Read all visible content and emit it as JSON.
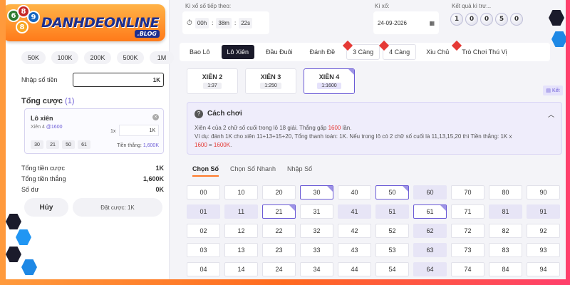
{
  "logo": {
    "text": "DANHDEONLINE",
    "sub": ".BLOG",
    "balls": [
      "6",
      "8",
      "9",
      "8"
    ]
  },
  "left": {
    "chips": [
      "50K",
      "100K",
      "200K",
      "500K",
      "1M"
    ],
    "amount_label": "Nhập số tiền",
    "amount_value": "1K",
    "total_label": "Tổng cược",
    "total_count": "(1)",
    "bet": {
      "title": "Lô xiên",
      "sub": "Xiên 4",
      "rate": "@1600",
      "mult_label": "1x",
      "mult_value": "1K",
      "numbers": [
        "30",
        "21",
        "50",
        "61"
      ],
      "win_label": "Tiền thắng:",
      "win_value": "1,600K"
    },
    "summary": [
      {
        "label": "Tổng tiền cược",
        "value": "1K"
      },
      {
        "label": "Tổng tiền thắng",
        "value": "1,600K"
      },
      {
        "label": "Số dư",
        "value": "0K"
      }
    ],
    "cancel": "Hủy",
    "place": "Đặt cược: 1K"
  },
  "top": {
    "next_label": "Kì xổ số tiếp theo:",
    "timer": [
      "00h",
      "38m",
      "22s"
    ],
    "date_label": "Kì xổ:",
    "date": "24-09-2026",
    "result_label": "Kết quả kì trư...",
    "result": [
      "1",
      "0",
      "0",
      "5",
      "0"
    ]
  },
  "tabs": [
    {
      "label": "Bao Lô"
    },
    {
      "label": "Lô Xiên"
    },
    {
      "label": "Đầu Đuôi"
    },
    {
      "label": "Đánh Đề"
    },
    {
      "label": "3 Càng"
    },
    {
      "label": "4 Càng"
    },
    {
      "label": "Xiu Chủ"
    },
    {
      "label": "Trò Chơi Thú Vị"
    }
  ],
  "subtabs": [
    {
      "label": "XIÊN 2",
      "rate": "1:37"
    },
    {
      "label": "XIÊN 3",
      "rate": "1:250"
    },
    {
      "label": "XIÊN 4",
      "rate": "1:1600"
    }
  ],
  "ket": "Kết",
  "howto": {
    "title": "Cách chơi",
    "line1a": "Xiên 4 của 2 chữ số cuối trong lô 18 giải. Thắng gấp ",
    "line1b": "1600",
    "line1c": " lần.",
    "line2": "Ví dụ: đánh 1K cho xiên 11+13+15+20, Tổng thanh toán: 1K. Nếu trong lô có 2 chữ số cuối là 11,13,15,20 thì Tiền thắng: 1K x",
    "line3a": "1600",
    "line3b": " = ",
    "line3c": "1600K",
    "line3d": "."
  },
  "numtabs": [
    "Chọn Số",
    "Chọn Số Nhanh",
    "Nhập Số"
  ],
  "numbers": [
    "00",
    "10",
    "20",
    "30",
    "40",
    "50",
    "60",
    "70",
    "80",
    "90",
    "01",
    "11",
    "21",
    "31",
    "41",
    "51",
    "61",
    "71",
    "81",
    "91",
    "02",
    "12",
    "22",
    "32",
    "42",
    "52",
    "62",
    "72",
    "82",
    "92",
    "03",
    "13",
    "23",
    "33",
    "43",
    "53",
    "63",
    "73",
    "83",
    "93",
    "04",
    "14",
    "24",
    "34",
    "44",
    "54",
    "64",
    "74",
    "84",
    "94"
  ],
  "selected": [
    "30",
    "50",
    "21",
    "61"
  ]
}
